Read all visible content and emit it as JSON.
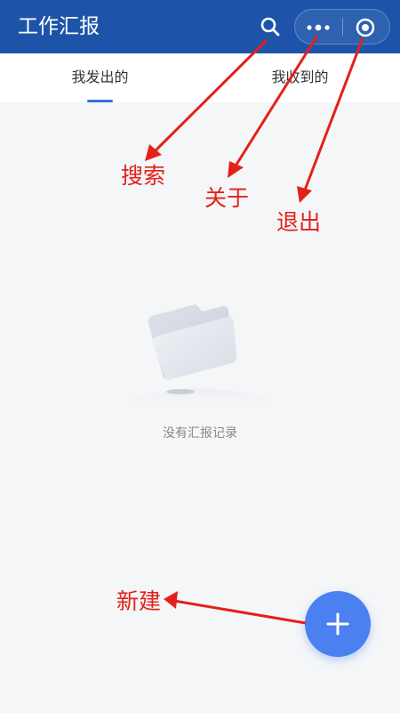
{
  "header": {
    "title": "工作汇报",
    "search_icon": "search-icon",
    "more_icon": "more-dots-icon",
    "exit_icon": "target-circle-icon",
    "background": "#1d54aa"
  },
  "tabs": [
    {
      "label": "我发出的",
      "active": true
    },
    {
      "label": "我收到的",
      "active": false
    }
  ],
  "empty_state": {
    "icon": "empty-folder-icon",
    "message": "没有汇报记录"
  },
  "fab": {
    "icon": "plus-icon",
    "color": "#4a80f0"
  },
  "annotations": {
    "search": "搜索",
    "about": "关于",
    "exit": "退出",
    "new": "新建",
    "color": "#e32119"
  }
}
